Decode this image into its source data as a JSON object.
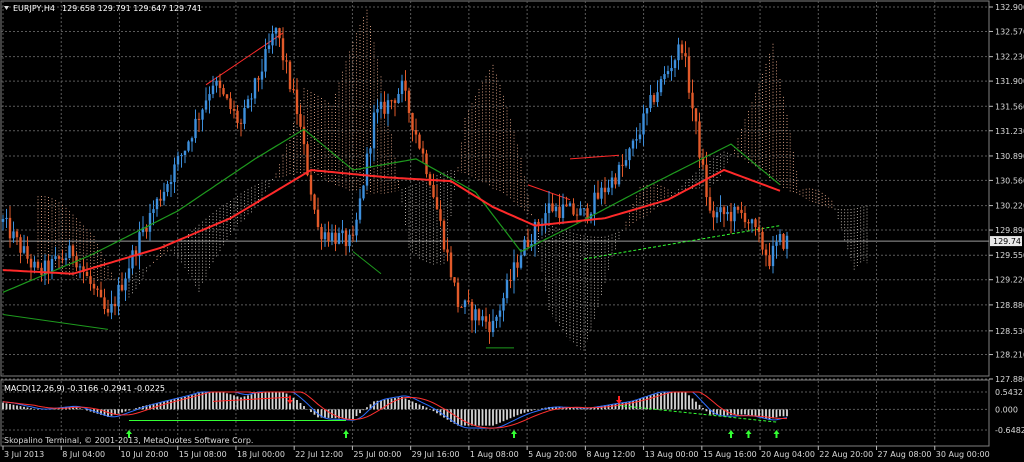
{
  "chart_header": {
    "symbol_timeframe": "EURJPY,H4",
    "ohlc": "129.658 129.791 129.647 129.741"
  },
  "price_axis": {
    "ticks": [
      "132.900",
      "132.570",
      "132.230",
      "131.900",
      "131.560",
      "131.230",
      "130.890",
      "130.560",
      "130.220",
      "129.890",
      "129.550",
      "129.220",
      "128.880",
      "128.530",
      "128.210",
      "127.880"
    ],
    "current_price": "129.741"
  },
  "macd_panel": {
    "label": "MACD(12,26,9) -0.3166 -0.2941 -0.0225",
    "ticks": [
      "0.5432",
      "0.000",
      "-0.6482"
    ]
  },
  "watermark": "Skopalino Terminal, © 2001-2013, MetaQuotes Software Corp.",
  "time_axis": {
    "labels": [
      "3 Jul 2013",
      "8 Jul 04:00",
      "10 Jul 20:00",
      "15 Jul 08:00",
      "18 Jul 00:00",
      "22 Jul 12:00",
      "25 Jul 00:00",
      "29 Jul 16:00",
      "1 Aug 08:00",
      "5 Aug 20:00",
      "8 Aug 12:00",
      "13 Aug 00:00",
      "15 Aug 16:00",
      "20 Aug 04:00",
      "22 Aug 20:00",
      "27 Aug 08:00",
      "30 Aug 00:00"
    ]
  },
  "colors": {
    "background": "#000000",
    "grid": "#5a5a5a",
    "bull_candle": "#3d8fdc",
    "bear_candle": "#e25a2a",
    "ema_red": "#ff2a2a",
    "ma_green": "#1e9a1e",
    "cloud_bull": "#f0b090",
    "cloud_bear": "#d0c8c0",
    "macd_hist": "#d8d8d8",
    "macd_main": "#2f6fff",
    "macd_signal": "#ff3030",
    "arrow_up": "#33ff33",
    "arrow_down": "#ff2020"
  },
  "chart_data": {
    "type": "candlestick",
    "symbol": "EURJPY",
    "timeframe": "H4",
    "ylim": [
      127.88,
      132.9
    ],
    "x_index_range": [
      0,
      224
    ],
    "candles_keypoints": [
      {
        "i": 0,
        "price": 130.0
      },
      {
        "i": 10,
        "price": 129.3
      },
      {
        "i": 20,
        "price": 129.6
      },
      {
        "i": 30,
        "price": 128.7
      },
      {
        "i": 40,
        "price": 129.9
      },
      {
        "i": 52,
        "price": 131.0
      },
      {
        "i": 60,
        "price": 131.9
      },
      {
        "i": 68,
        "price": 131.3
      },
      {
        "i": 78,
        "price": 132.6
      },
      {
        "i": 84,
        "price": 131.5
      },
      {
        "i": 90,
        "price": 129.9
      },
      {
        "i": 100,
        "price": 129.7
      },
      {
        "i": 106,
        "price": 131.4
      },
      {
        "i": 114,
        "price": 131.8
      },
      {
        "i": 122,
        "price": 130.6
      },
      {
        "i": 130,
        "price": 128.9
      },
      {
        "i": 140,
        "price": 128.6
      },
      {
        "i": 148,
        "price": 129.6
      },
      {
        "i": 156,
        "price": 130.2
      },
      {
        "i": 166,
        "price": 130.1
      },
      {
        "i": 178,
        "price": 130.8
      },
      {
        "i": 186,
        "price": 131.7
      },
      {
        "i": 194,
        "price": 132.4
      },
      {
        "i": 202,
        "price": 130.1
      },
      {
        "i": 212,
        "price": 130.1
      },
      {
        "i": 219,
        "price": 129.5
      },
      {
        "i": 222,
        "price": 129.74
      }
    ],
    "ema_red": [
      {
        "i": 0,
        "price": 129.35
      },
      {
        "i": 20,
        "price": 129.3
      },
      {
        "i": 45,
        "price": 129.65
      },
      {
        "i": 65,
        "price": 130.05
      },
      {
        "i": 88,
        "price": 130.7
      },
      {
        "i": 110,
        "price": 130.6
      },
      {
        "i": 128,
        "price": 130.55
      },
      {
        "i": 140,
        "price": 130.2
      },
      {
        "i": 152,
        "price": 129.95
      },
      {
        "i": 172,
        "price": 130.05
      },
      {
        "i": 190,
        "price": 130.3
      },
      {
        "i": 206,
        "price": 130.7
      },
      {
        "i": 222,
        "price": 130.42
      }
    ],
    "ma_green": [
      {
        "i": 0,
        "price": 129.05
      },
      {
        "i": 25,
        "price": 129.55
      },
      {
        "i": 50,
        "price": 130.15
      },
      {
        "i": 72,
        "price": 130.85
      },
      {
        "i": 86,
        "price": 131.25
      },
      {
        "i": 100,
        "price": 130.7
      },
      {
        "i": 118,
        "price": 130.85
      },
      {
        "i": 135,
        "price": 130.4
      },
      {
        "i": 148,
        "price": 129.6
      },
      {
        "i": 165,
        "price": 130.0
      },
      {
        "i": 185,
        "price": 130.5
      },
      {
        "i": 208,
        "price": 131.05
      },
      {
        "i": 222,
        "price": 130.5
      }
    ],
    "macd": {
      "current_main": -0.3166,
      "current_signal": -0.2941,
      "current_hist": -0.0225,
      "ylim": [
        -0.6482,
        0.5432
      ]
    },
    "current_price": 129.741
  }
}
